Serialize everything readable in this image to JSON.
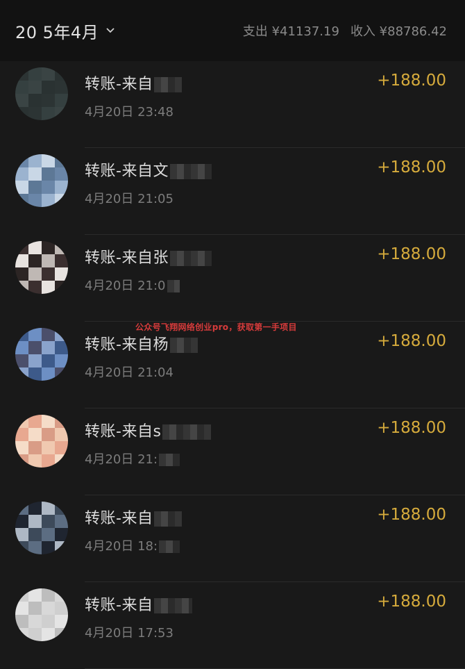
{
  "header": {
    "month": "20 5年4月",
    "expense": "支出 ¥41137.19",
    "income": "收入 ¥88786.42"
  },
  "watermark": "公众号飞翔网络创业pro，获取第一手项目",
  "transactions": [
    {
      "title": "转账-来自",
      "time": "4月20日 23:48",
      "amount": "+188.00",
      "avatar_colors": [
        "#2c3434",
        "#354040",
        "#3a4444",
        "#2a3232"
      ]
    },
    {
      "title": "转账-来自文",
      "time": "4月20日 21:05",
      "amount": "+188.00",
      "avatar_colors": [
        "#6a86a8",
        "#9bb3cf",
        "#c9d7e6",
        "#5d7896"
      ]
    },
    {
      "title": "转账-来自张",
      "time": "4月20日 21:0",
      "amount": "+188.00",
      "avatar_colors": [
        "#3b2f2f",
        "#e8e3e0",
        "#2c2524",
        "#bfb8b4"
      ]
    },
    {
      "title": "转账-来自杨",
      "time": "4月20日 21:04",
      "amount": "+188.00",
      "avatar_colors": [
        "#3d5a8a",
        "#6d8fc4",
        "#4b4f6b",
        "#8aa3cc"
      ]
    },
    {
      "title": "转账-来自s",
      "time": "4月20日 21:",
      "amount": "+188.00",
      "avatar_colors": [
        "#f0c9b0",
        "#e8a890",
        "#f5dcc8",
        "#d99c86"
      ]
    },
    {
      "title": "转账-来自",
      "time": "4月20日 18:",
      "amount": "+188.00",
      "avatar_colors": [
        "#5c6d82",
        "#1f2530",
        "#aeb8c4",
        "#3d4a5a"
      ]
    },
    {
      "title": "转账-来自",
      "time": "4月20日 17:53",
      "amount": "+188.00",
      "avatar_colors": [
        "#cfcfcf",
        "#e4e4e4",
        "#bdbdbd",
        "#d8d8d8"
      ]
    }
  ]
}
